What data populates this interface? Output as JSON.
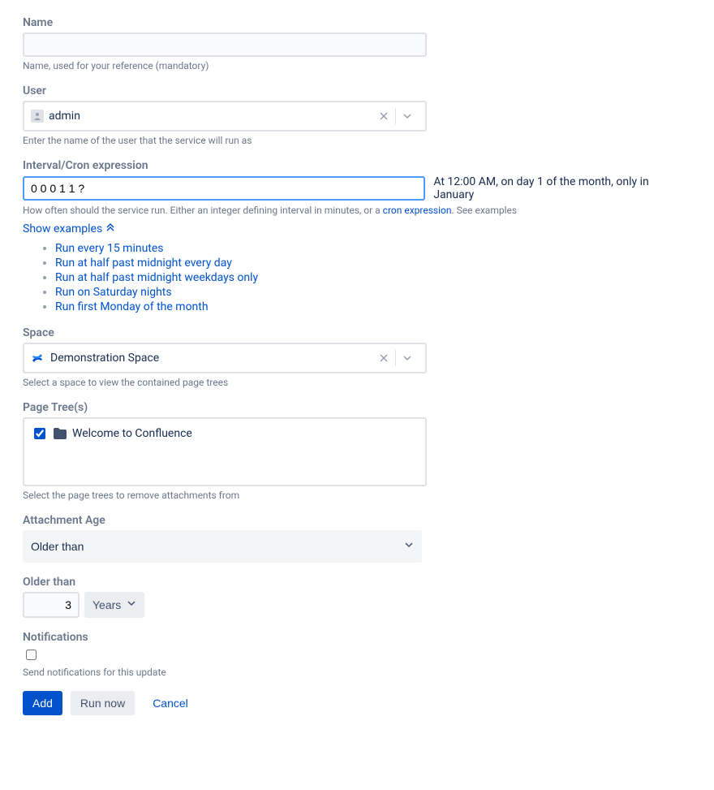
{
  "name": {
    "label": "Name",
    "value": "",
    "help": "Name, used for your reference (mandatory)"
  },
  "user": {
    "label": "User",
    "value": "admin",
    "help": "Enter the name of the user that the service will run as"
  },
  "interval": {
    "label": "Interval/Cron expression",
    "value": "0 0 0 1 1 ?",
    "description": "At 12:00 AM, on day 1 of the month, only in January",
    "help_prefix": "How often should the service run. Either an integer defining interval in minutes, or a ",
    "help_link": "cron expression",
    "help_suffix": ". See examples",
    "show_examples": "Show examples",
    "examples": [
      "Run every 15 minutes",
      "Run at half past midnight every day",
      "Run at half past midnight weekdays only",
      "Run on Saturday nights",
      "Run first Monday of the month"
    ]
  },
  "space": {
    "label": "Space",
    "value": "Demonstration Space",
    "help": "Select a space to view the contained page trees"
  },
  "page_trees": {
    "label": "Page Tree(s)",
    "items": [
      {
        "checked": true,
        "label": "Welcome to Confluence"
      }
    ],
    "help": "Select the page trees to remove attachments from"
  },
  "attachment_age": {
    "label": "Attachment Age",
    "selected": "Older than"
  },
  "older_than": {
    "label": "Older than",
    "value": "3",
    "unit": "Years"
  },
  "notifications": {
    "label": "Notifications",
    "checked": false,
    "help": "Send notifications for this update"
  },
  "buttons": {
    "add": "Add",
    "run_now": "Run now",
    "cancel": "Cancel"
  }
}
